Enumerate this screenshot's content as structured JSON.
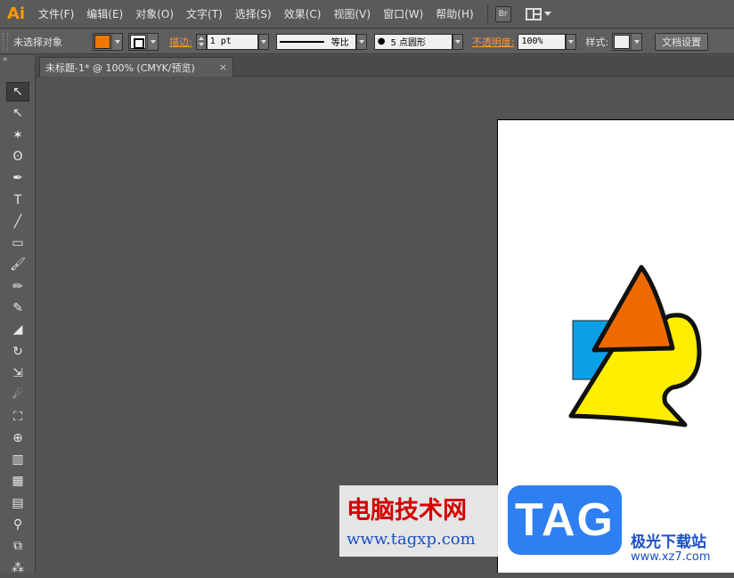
{
  "app": {
    "logo": "Ai"
  },
  "menu": [
    "文件(F)",
    "编辑(E)",
    "对象(O)",
    "文字(T)",
    "选择(S)",
    "效果(C)",
    "视图(V)",
    "窗口(W)",
    "帮助(H)"
  ],
  "bridge_button": "Br",
  "control_bar": {
    "selection_label": "未选择对象",
    "fill_color": "#f07800",
    "stroke_label": "描边:",
    "stroke_weight": "1 pt",
    "profile_label": "等比",
    "brush_label": "5 点圆形",
    "opacity_label": "不透明度:",
    "opacity_value": "100%",
    "style_label": "样式:",
    "doc_setup_button": "文档设置"
  },
  "document_tab": {
    "title": "未标题-1* @ 100% (CMYK/预览)",
    "close": "×"
  },
  "toolbox": {
    "grip": "»",
    "tools": [
      {
        "icon": "selection-tool-icon",
        "glyph": "↖",
        "active": true
      },
      {
        "icon": "direct-selection-tool-icon",
        "glyph": "↖",
        "active": false
      },
      {
        "icon": "magic-wand-tool-icon",
        "glyph": "✶",
        "active": false
      },
      {
        "icon": "lasso-tool-icon",
        "glyph": "ʘ",
        "active": false
      },
      {
        "icon": "pen-tool-icon",
        "glyph": "✒",
        "active": false
      },
      {
        "icon": "type-tool-icon",
        "glyph": "T",
        "active": false
      },
      {
        "icon": "line-tool-icon",
        "glyph": "╱",
        "active": false
      },
      {
        "icon": "rectangle-tool-icon",
        "glyph": "▭",
        "active": false
      },
      {
        "icon": "paintbrush-tool-icon",
        "glyph": "🖌",
        "active": false
      },
      {
        "icon": "pencil-tool-icon",
        "glyph": "✏",
        "active": false
      },
      {
        "icon": "blob-brush-tool-icon",
        "glyph": "✎",
        "active": false
      },
      {
        "icon": "eraser-tool-icon",
        "glyph": "◢",
        "active": false
      },
      {
        "icon": "rotate-tool-icon",
        "glyph": "↻",
        "active": false
      },
      {
        "icon": "scale-tool-icon",
        "glyph": "⇲",
        "active": false
      },
      {
        "icon": "warp-tool-icon",
        "glyph": "☄",
        "active": false
      },
      {
        "icon": "free-transform-tool-icon",
        "glyph": "⛶",
        "active": false
      },
      {
        "icon": "shape-builder-tool-icon",
        "glyph": "⊕",
        "active": false
      },
      {
        "icon": "graph-tool-icon",
        "glyph": "▥",
        "active": false
      },
      {
        "icon": "mesh-tool-icon",
        "glyph": "▦",
        "active": false
      },
      {
        "icon": "gradient-tool-icon",
        "glyph": "▤",
        "active": false
      },
      {
        "icon": "eyedropper-tool-icon",
        "glyph": "⚲",
        "active": false
      },
      {
        "icon": "blend-tool-icon",
        "glyph": "⧉",
        "active": false
      },
      {
        "icon": "symbol-sprayer-tool-icon",
        "glyph": "⁂",
        "active": false
      }
    ]
  },
  "artwork": {
    "rect_fill": "#0aa0e8",
    "yellow_fill": "#ffee00",
    "triangle_fill": "#ee6a00"
  },
  "watermark": {
    "cn": "电脑技术网",
    "url": "www.tagxp.com",
    "tag": "TAG",
    "site_cn": "极光下载站",
    "site_url": "www.xz7.com"
  }
}
